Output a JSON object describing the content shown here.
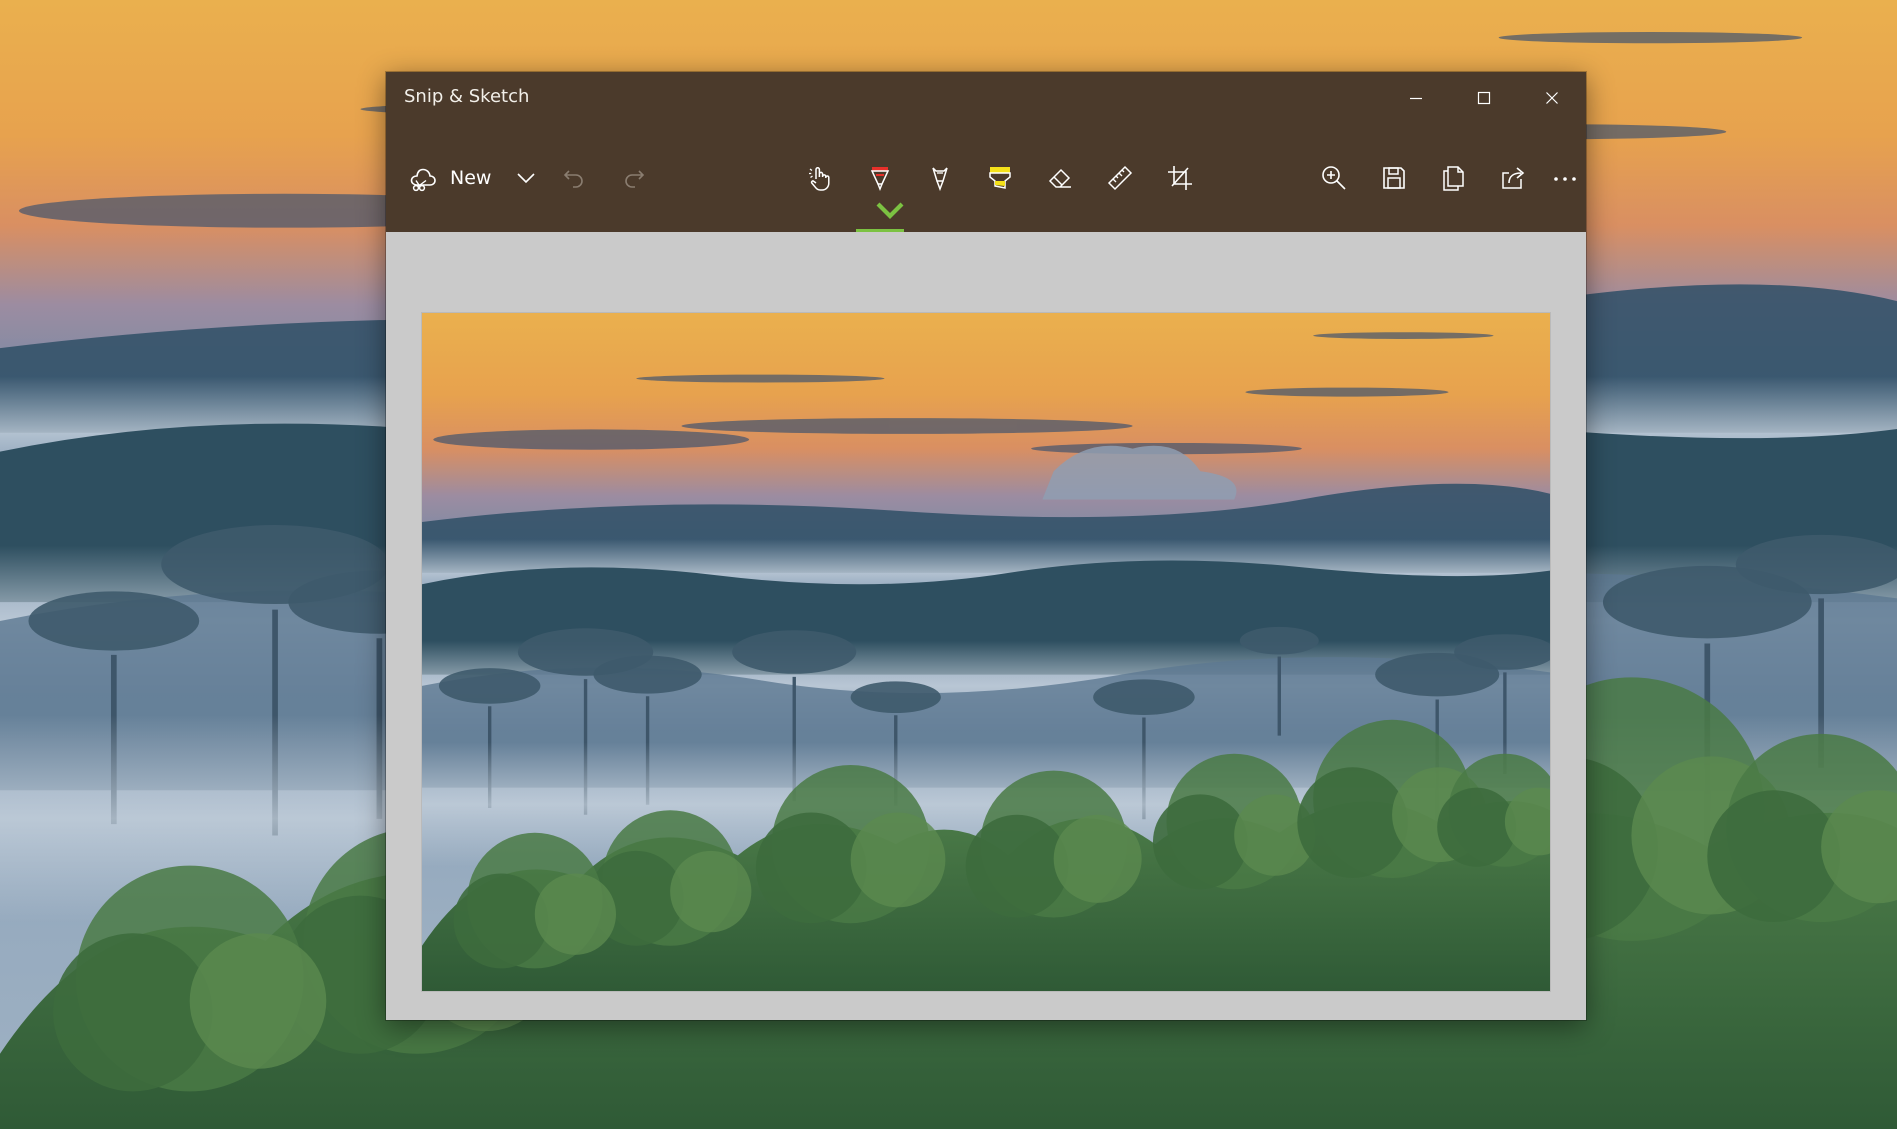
{
  "window": {
    "title": "Snip & Sketch",
    "minimize_icon": "minimize-icon",
    "maximize_icon": "maximize-icon",
    "close_icon": "close-icon"
  },
  "toolbar": {
    "new_label": "New",
    "icons": {
      "new": "snip-new-icon",
      "dropdown": "chevron-down-icon",
      "undo": "undo-icon",
      "redo": "redo-icon",
      "touch_writing": "touch-writing-icon",
      "ballpoint_pen": "ballpoint-pen-icon",
      "pencil": "pencil-icon",
      "highlighter": "highlighter-icon",
      "eraser": "eraser-icon",
      "ruler": "ruler-icon",
      "crop": "crop-icon",
      "zoom": "zoom-in-icon",
      "save": "save-icon",
      "copy": "copy-icon",
      "share": "share-icon",
      "more": "more-icon"
    },
    "active_tool": "ballpoint_pen"
  },
  "colors": {
    "titlebar": "#4b3a2b",
    "canvas": "#cacaca",
    "active_indicator": "#7cc242",
    "pen_color": "#e8302a",
    "highlighter_color": "#f5e11a",
    "disabled_icon": "#8a7d70"
  }
}
